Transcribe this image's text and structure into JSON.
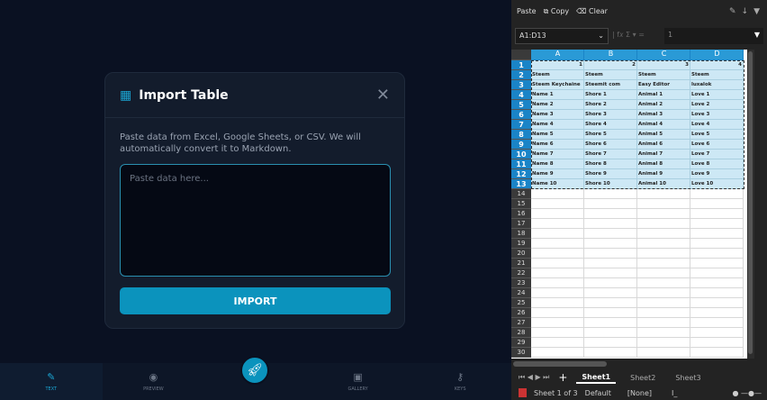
{
  "modal": {
    "title": "Import Table",
    "description": "Paste data from Excel, Google Sheets, or CSV. We will automatically convert it to Markdown.",
    "placeholder": "Paste data here...",
    "import_label": "IMPORT"
  },
  "nav": [
    {
      "label": "TEXT",
      "icon": "pencil-icon"
    },
    {
      "label": "PREVIEW",
      "icon": "eye-icon"
    },
    {
      "label": "",
      "icon": "rocket-icon"
    },
    {
      "label": "GALLERY",
      "icon": "image-icon"
    },
    {
      "label": "KEYS",
      "icon": "key-icon"
    }
  ],
  "sheet": {
    "toolbar": {
      "paste": "Paste",
      "copy": "Copy",
      "clear": "Clear"
    },
    "name_box": "A1:D13",
    "formula": "1",
    "columns": [
      "A",
      "B",
      "C",
      "D"
    ],
    "rows": [
      [
        "1",
        "2",
        "3",
        "4"
      ],
      [
        "Steem",
        "Steem",
        "Steem",
        "Steem"
      ],
      [
        "Steem Keychaine",
        "Steemit com",
        "Easy Editor",
        "luxalok"
      ],
      [
        "Name 1",
        "Shore 1",
        "Animal 1",
        "Love 1"
      ],
      [
        "Name 2",
        "Shore 2",
        "Animal 2",
        "Love 2"
      ],
      [
        "Name 3",
        "Shore 3",
        "Animal 3",
        "Love 3"
      ],
      [
        "Name 4",
        "Shore 4",
        "Animal 4",
        "Love 4"
      ],
      [
        "Name 5",
        "Shore 5",
        "Animal 5",
        "Love 5"
      ],
      [
        "Name 6",
        "Shore 6",
        "Animal 6",
        "Love 6"
      ],
      [
        "Name 7",
        "Shore 7",
        "Animal 7",
        "Love 7"
      ],
      [
        "Name 8",
        "Shore 8",
        "Animal 8",
        "Love 8"
      ],
      [
        "Name 9",
        "Shore 9",
        "Animal 9",
        "Love 9"
      ],
      [
        "Name 10",
        "Shore 10",
        "Animal 10",
        "Love 10"
      ]
    ],
    "total_rows": 30,
    "tabs": [
      "Sheet1",
      "Sheet2",
      "Sheet3"
    ],
    "status": {
      "sheet": "Sheet 1 of 3",
      "style": "Default",
      "lang": "[None]"
    }
  }
}
